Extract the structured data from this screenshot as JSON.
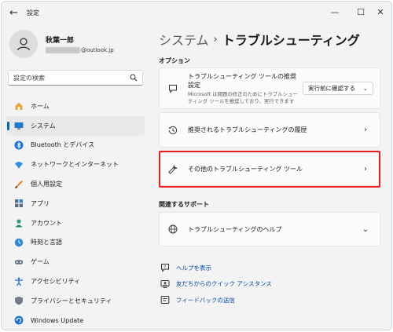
{
  "window": {
    "title": "設定",
    "back_glyph": "←",
    "minimize_glyph": "—",
    "maximize_glyph": "☐",
    "close_glyph": "✕"
  },
  "account": {
    "name": "秋葉一郎",
    "email_suffix": "@outlook.jp"
  },
  "search": {
    "placeholder": "設定の検索"
  },
  "sidebar": {
    "items": [
      {
        "label": "ホーム",
        "icon": "home-icon",
        "active": false
      },
      {
        "label": "システム",
        "icon": "system-icon",
        "active": true
      },
      {
        "label": "Bluetooth とデバイス",
        "icon": "bluetooth-icon",
        "active": false
      },
      {
        "label": "ネットワークとインターネット",
        "icon": "network-icon",
        "active": false
      },
      {
        "label": "個人用設定",
        "icon": "personalization-icon",
        "active": false
      },
      {
        "label": "アプリ",
        "icon": "apps-icon",
        "active": false
      },
      {
        "label": "アカウント",
        "icon": "accounts-icon",
        "active": false
      },
      {
        "label": "時刻と言語",
        "icon": "time-language-icon",
        "active": false
      },
      {
        "label": "ゲーム",
        "icon": "gaming-icon",
        "active": false
      },
      {
        "label": "アクセシビリティ",
        "icon": "accessibility-icon",
        "active": false
      },
      {
        "label": "プライバシーとセキュリティ",
        "icon": "privacy-shield-icon",
        "active": false
      },
      {
        "label": "Windows Update",
        "icon": "windows-update-icon",
        "active": false
      }
    ]
  },
  "breadcrumb": {
    "parent": "システム",
    "separator": "›",
    "current": "トラブルシューティング"
  },
  "options": {
    "heading": "オプション",
    "recommended": {
      "title": "トラブルシューティング ツールの推奨設定",
      "description": "Microsoft は問題の修正のためにトラブルシューティング ツールを推奨しており、実行できます",
      "dropdown_value": "実行前に確認する",
      "dropdown_glyph": "⌄"
    },
    "history": {
      "title": "推奨されるトラブルシューティングの履歴",
      "chevron": "›"
    },
    "other": {
      "title": "その他のトラブルシューティング ツール",
      "chevron": "›"
    }
  },
  "support": {
    "heading": "関連するサポート",
    "help": {
      "title": "トラブルシューティングのヘルプ",
      "chevron": "⌄"
    }
  },
  "links": [
    {
      "label": "ヘルプを表示",
      "icon": "help-icon"
    },
    {
      "label": "友だちからのクイック アシスタンス",
      "icon": "quick-assist-icon"
    },
    {
      "label": "フィードバックの送信",
      "icon": "feedback-icon"
    }
  ],
  "colors": {
    "accent": "#0067c0",
    "highlight_border": "#e8201e",
    "link": "#0049a8"
  }
}
